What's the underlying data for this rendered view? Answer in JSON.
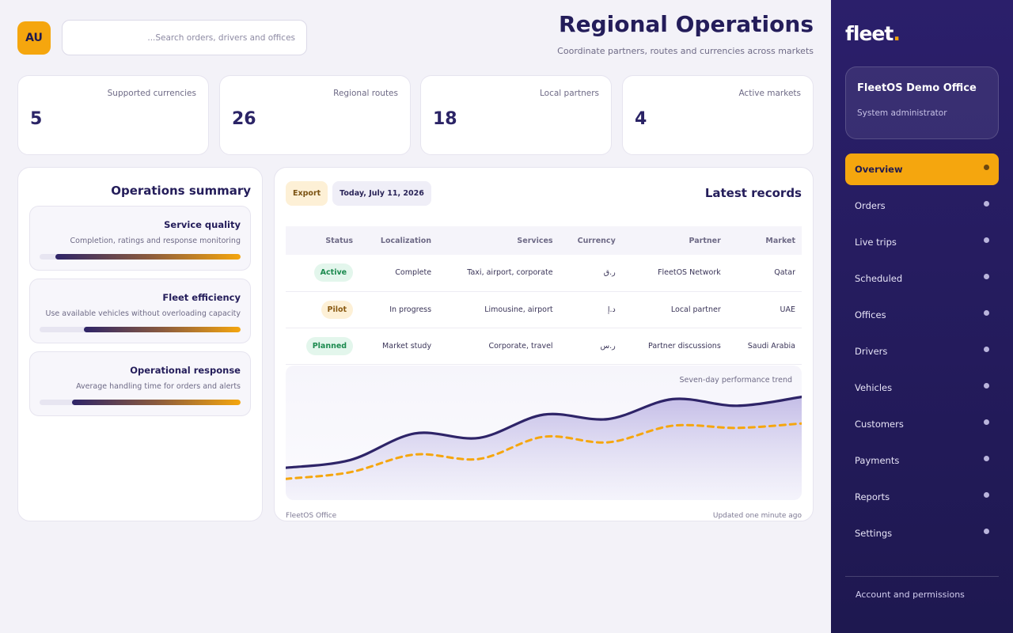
{
  "user": {
    "initials": "AU"
  },
  "search": {
    "placeholder": "...Search orders, drivers and offices",
    "value": ""
  },
  "header": {
    "title": "Regional Operations",
    "subtitle": "Coordinate partners, routes and currencies across markets"
  },
  "stats": [
    {
      "label": "Active markets",
      "value": "4"
    },
    {
      "label": "Local partners",
      "value": "18"
    },
    {
      "label": "Regional routes",
      "value": "26"
    },
    {
      "label": "Supported currencies",
      "value": "5"
    }
  ],
  "summary": {
    "title": "Operations summary",
    "metrics": [
      {
        "title": "Service quality",
        "desc": "Completion, ratings and response monitoring",
        "level": 0.92
      },
      {
        "title": "Fleet efficiency",
        "desc": "Use available vehicles without overloading capacity",
        "level": 0.78
      },
      {
        "title": "Operational response",
        "desc": "Average handling time for orders and alerts",
        "level": 0.84
      }
    ]
  },
  "records": {
    "title": "Latest records",
    "export_label": "Export",
    "date_label": "Today, July 11, 2026",
    "columns": [
      "Market",
      "Partner",
      "Currency",
      "Services",
      "Localization",
      "Status"
    ],
    "rows": [
      {
        "market": "Qatar",
        "partner": "FleetOS Network",
        "currency": "ر.ق",
        "services": "Taxi, airport, corporate",
        "localization": "Complete",
        "status": "Active"
      },
      {
        "market": "UAE",
        "partner": "Local partner",
        "currency": "د.إ",
        "services": "Limousine, airport",
        "localization": "In progress",
        "status": "Pilot"
      },
      {
        "market": "Saudi Arabia",
        "partner": "Partner discussions",
        "currency": "ر.س",
        "services": "Corporate, travel",
        "localization": "Market study",
        "status": "Planned"
      }
    ],
    "status_colors": {
      "Active": {
        "bg": "#e3f6ec",
        "fg": "#1c8a4f"
      },
      "Pilot": {
        "bg": "#fdf0d6",
        "fg": "#8a5a12"
      },
      "Planned": {
        "bg": "#e3f6ec",
        "fg": "#1c8a4f"
      }
    },
    "chart_label": "Seven-day performance trend",
    "footer_left": "FleetOS Office",
    "footer_right": "Updated one minute ago"
  },
  "chart_data": {
    "type": "area",
    "title": "Seven-day performance trend",
    "x": [
      1,
      2,
      3,
      4,
      5,
      6,
      7,
      8,
      9
    ],
    "series": [
      {
        "values": [
          0.22,
          0.29,
          0.53,
          0.49,
          0.7,
          0.66,
          0.84,
          0.78,
          0.86
        ],
        "color": "#2e2468",
        "fill": true
      },
      {
        "values": [
          0.12,
          0.18,
          0.34,
          0.3,
          0.5,
          0.45,
          0.6,
          0.58,
          0.62
        ],
        "color": "#f5a60e",
        "dashed": true
      }
    ],
    "ylim": [
      0,
      1
    ],
    "grid": false
  },
  "sidebar": {
    "brand": "fleet",
    "brand_dot": ".",
    "org_name": "FleetOS Demo Office",
    "org_role": "System administrator",
    "items": [
      {
        "label": "Overview",
        "active": true
      },
      {
        "label": "Orders"
      },
      {
        "label": "Live trips"
      },
      {
        "label": "Scheduled"
      },
      {
        "label": "Offices"
      },
      {
        "label": "Drivers"
      },
      {
        "label": "Vehicles"
      },
      {
        "label": "Customers"
      },
      {
        "label": "Payments"
      },
      {
        "label": "Reports"
      },
      {
        "label": "Settings"
      }
    ],
    "footer": "Account and permissions"
  },
  "colors": {
    "accent": "#f5a60e",
    "primary": "#2b1f6b",
    "background": "#f3f2f8"
  }
}
